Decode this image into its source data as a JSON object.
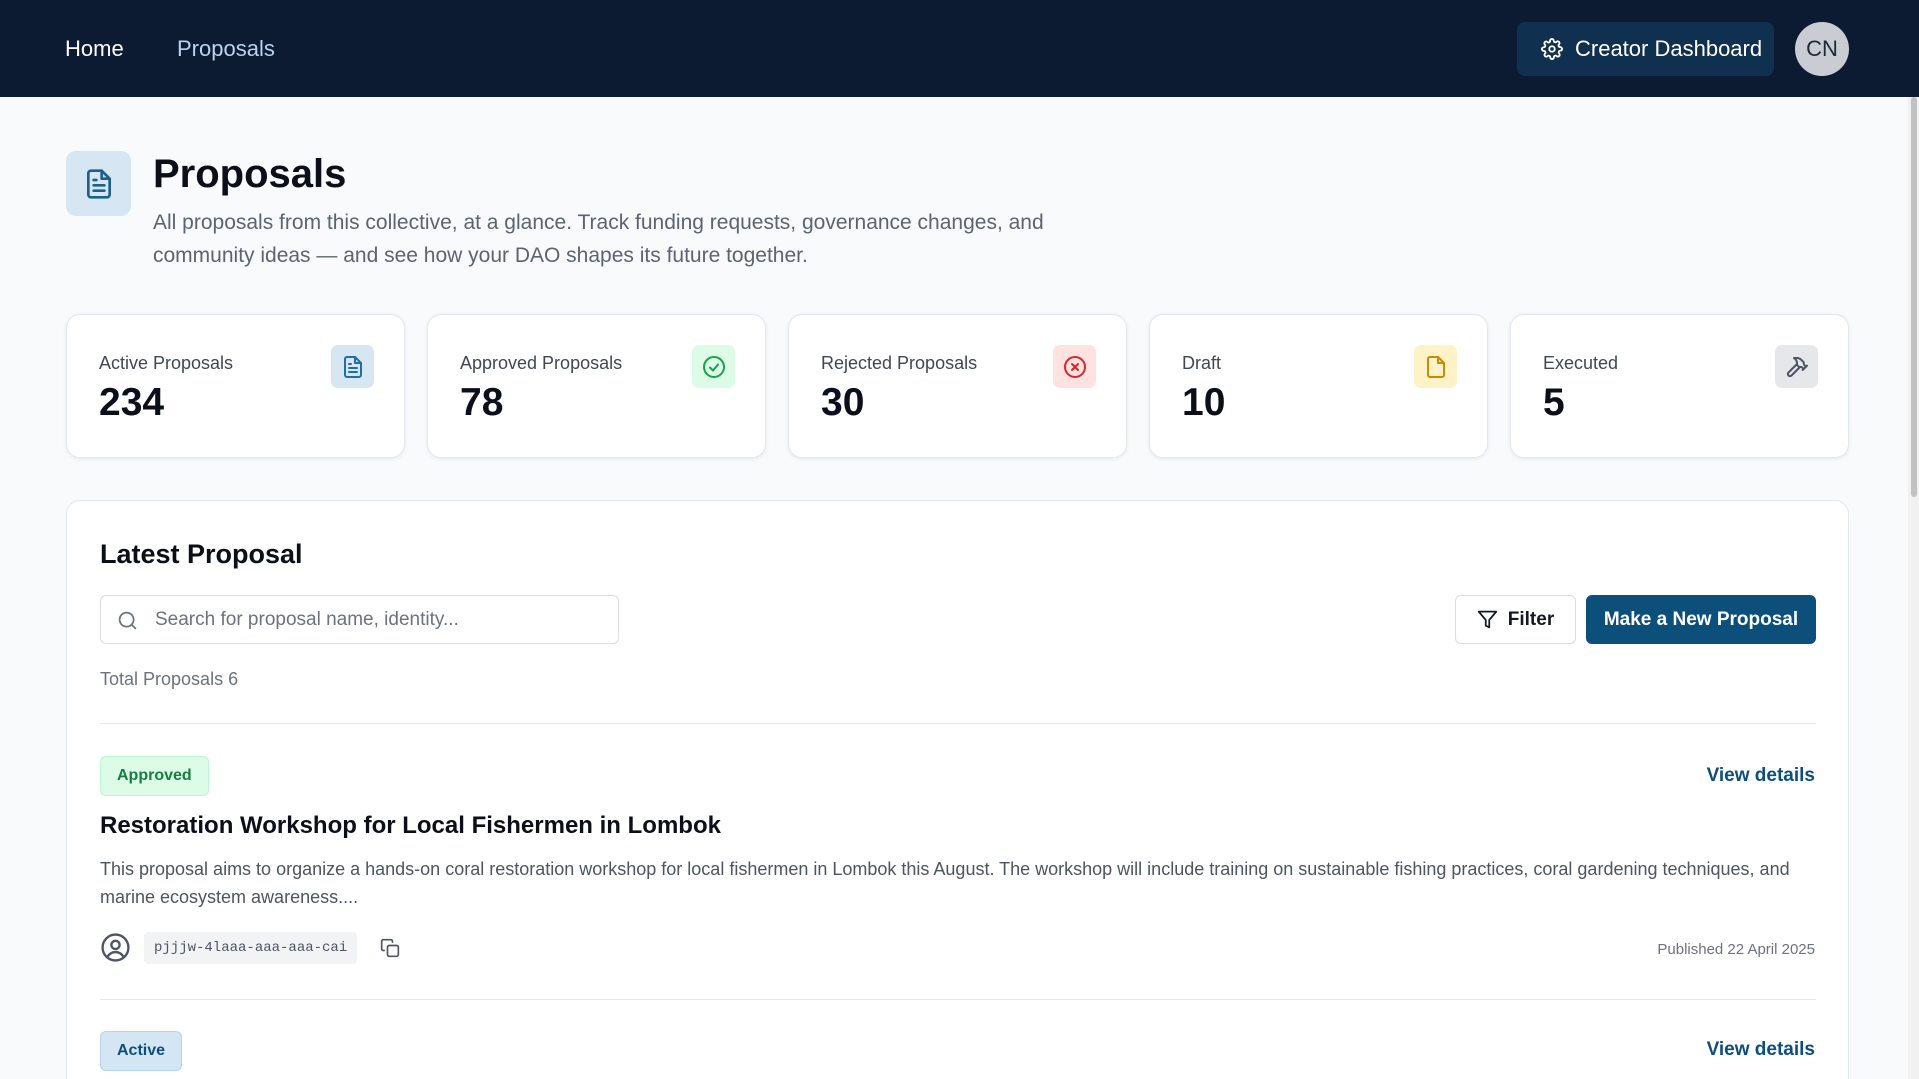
{
  "nav": {
    "home": "Home",
    "proposals": "Proposals",
    "creator_dashboard": "Creator Dashboard",
    "avatar_initials": "CN"
  },
  "header": {
    "title": "Proposals",
    "description": "All proposals from this collective, at a glance. Track funding requests, governance changes, and community ideas — and see how your DAO shapes its future together."
  },
  "stats": [
    {
      "label": "Active Proposals",
      "value": "234",
      "icon": "document-icon",
      "color": "#1e6fa8",
      "bg": "#d6e6f2"
    },
    {
      "label": "Approved Proposals",
      "value": "78",
      "icon": "check-circle-icon",
      "color": "#16a34a",
      "bg": "#dcfce7"
    },
    {
      "label": "Rejected Proposals",
      "value": "30",
      "icon": "x-circle-icon",
      "color": "#dc2626",
      "bg": "#fee2e2"
    },
    {
      "label": "Draft",
      "value": "10",
      "icon": "file-icon",
      "color": "#ca8a04",
      "bg": "#fef3c7"
    },
    {
      "label": "Executed",
      "value": "5",
      "icon": "hammer-icon",
      "color": "#4b5563",
      "bg": "#e5e7eb"
    }
  ],
  "latest": {
    "title": "Latest Proposal",
    "search_placeholder": "Search for proposal name, identity...",
    "filter_label": "Filter",
    "new_button": "Make a New Proposal",
    "total_text": "Total Proposals 6"
  },
  "proposals": [
    {
      "status": "Approved",
      "view": "View details",
      "title": "Restoration Workshop for Local Fishermen in Lombok",
      "description": "This proposal aims to organize a hands-on coral restoration workshop for local fishermen in Lombok this August. The workshop will include training on sustainable fishing practices, coral gardening techniques, and marine ecosystem awareness....",
      "identity": "pjjjw-4laaa-aaa-aaa-cai",
      "published": "Published 22 April 2025"
    },
    {
      "status": "Active",
      "view": "View details"
    }
  ],
  "colors": {
    "nav_bg": "#0c1a32",
    "accent": "#0c4f7a",
    "page_bg": "#f8fafc"
  }
}
